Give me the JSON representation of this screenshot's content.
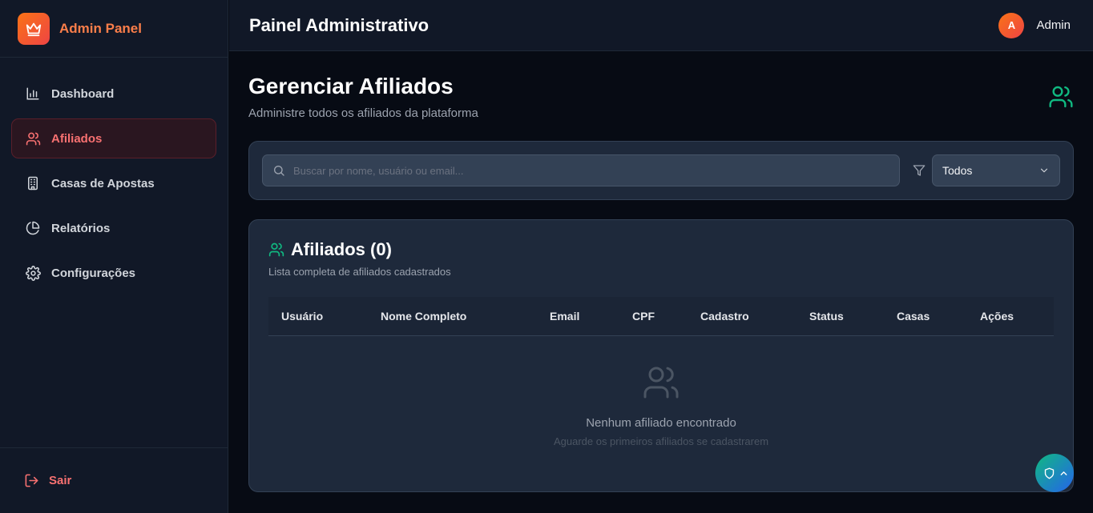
{
  "brand": {
    "title": "Admin Panel",
    "logo_icon": "crown-icon"
  },
  "sidebar": {
    "items": [
      {
        "label": "Dashboard",
        "icon": "bar-chart-icon",
        "active": false
      },
      {
        "label": "Afiliados",
        "icon": "users-icon",
        "active": true
      },
      {
        "label": "Casas de Apostas",
        "icon": "building-icon",
        "active": false
      },
      {
        "label": "Relatórios",
        "icon": "pie-chart-icon",
        "active": false
      },
      {
        "label": "Configurações",
        "icon": "gear-icon",
        "active": false
      }
    ],
    "logout_label": "Sair"
  },
  "header": {
    "title": "Painel Administrativo",
    "avatar_initial": "A",
    "user_name": "Admin"
  },
  "page": {
    "title": "Gerenciar Afiliados",
    "subtitle": "Administre todos os afiliados da plataforma"
  },
  "filters": {
    "search_placeholder": "Buscar por nome, usuário ou email...",
    "status_selected": "Todos"
  },
  "table": {
    "title": "Afiliados (0)",
    "subtitle": "Lista completa de afiliados cadastrados",
    "columns": [
      "Usuário",
      "Nome Completo",
      "Email",
      "CPF",
      "Cadastro",
      "Status",
      "Casas",
      "Ações"
    ],
    "rows": [],
    "empty_title": "Nenhum afiliado encontrado",
    "empty_subtitle": "Aguarde os primeiros afiliados se cadastrarem"
  },
  "colors": {
    "accent": "#f97316",
    "active_nav": "#f87171",
    "green": "#10b981"
  }
}
